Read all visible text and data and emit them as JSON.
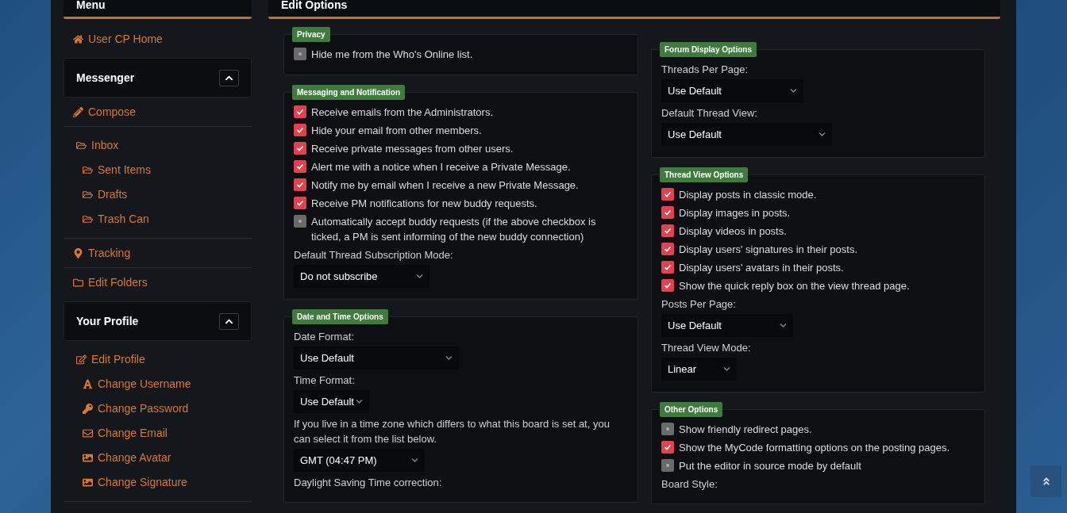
{
  "sidebar": {
    "title": "Menu",
    "top_link": {
      "label": "User CP Home"
    },
    "sections": [
      {
        "title": "Messenger",
        "expanded": true,
        "items": [
          {
            "label": "Compose"
          },
          {
            "label": "Inbox",
            "children": [
              {
                "label": "Sent Items"
              },
              {
                "label": "Drafts"
              },
              {
                "label": "Trash Can"
              }
            ]
          },
          {
            "label": "Tracking"
          },
          {
            "label": "Edit Folders"
          }
        ]
      },
      {
        "title": "Your Profile",
        "expanded": true,
        "items": [
          {
            "label": "Edit Profile",
            "children": [
              {
                "label": "Change Username"
              },
              {
                "label": "Change Password"
              },
              {
                "label": "Change Email"
              },
              {
                "label": "Change Avatar"
              },
              {
                "label": "Change Signature"
              }
            ]
          }
        ]
      }
    ]
  },
  "main": {
    "title": "Edit Options",
    "left_column": [
      {
        "legend": "Privacy",
        "fields": [
          {
            "kind": "checkbox",
            "label": "Hide me from the Who's Online list.",
            "checked": false
          }
        ]
      },
      {
        "legend": "Messaging and Notification",
        "fields": [
          {
            "kind": "checkbox",
            "label": "Receive emails from the Administrators.",
            "checked": true
          },
          {
            "kind": "checkbox",
            "label": "Hide your email from other members.",
            "checked": true
          },
          {
            "kind": "checkbox",
            "label": "Receive private messages from other users.",
            "checked": true
          },
          {
            "kind": "checkbox",
            "label": "Alert me with a notice when I receive a Private Message.",
            "checked": true
          },
          {
            "kind": "checkbox",
            "label": "Notify me by email when I receive a new Private Message.",
            "checked": true
          },
          {
            "kind": "checkbox",
            "label": "Receive PM notifications for new buddy requests.",
            "checked": true
          },
          {
            "kind": "checkbox",
            "label": "Automatically accept buddy requests (if the above checkbox is ticked, a PM is sent informing of the new buddy connection)",
            "checked": false
          },
          {
            "kind": "label",
            "text": "Default Thread Subscription Mode:"
          },
          {
            "kind": "select",
            "value": "Do not subscribe"
          }
        ]
      },
      {
        "legend": "Date and Time Options",
        "fields": [
          {
            "kind": "label",
            "text": "Date Format:"
          },
          {
            "kind": "select",
            "value": "Use Default"
          },
          {
            "kind": "label",
            "text": "Time Format:"
          },
          {
            "kind": "select",
            "value": "Use Default"
          },
          {
            "kind": "label",
            "text": "If you live in a time zone which differs to what this board is set at, you can select it from the list below."
          },
          {
            "kind": "select",
            "value": "GMT (04:47 PM)"
          },
          {
            "kind": "label",
            "text": "Daylight Saving Time correction:"
          }
        ]
      }
    ],
    "right_column": [
      {
        "legend": "Forum Display Options",
        "fields": [
          {
            "kind": "label",
            "text": "Threads Per Page:"
          },
          {
            "kind": "select",
            "value": "Use Default"
          },
          {
            "kind": "label",
            "text": "Default Thread View:"
          },
          {
            "kind": "select",
            "value": "Use Default"
          }
        ]
      },
      {
        "legend": "Thread View Options",
        "fields": [
          {
            "kind": "checkbox",
            "label": "Display posts in classic mode.",
            "checked": true
          },
          {
            "kind": "checkbox",
            "label": "Display images in posts.",
            "checked": true
          },
          {
            "kind": "checkbox",
            "label": "Display videos in posts.",
            "checked": true
          },
          {
            "kind": "checkbox",
            "label": "Display users' signatures in their posts.",
            "checked": true
          },
          {
            "kind": "checkbox",
            "label": "Display users' avatars in their posts.",
            "checked": true
          },
          {
            "kind": "checkbox",
            "label": "Show the quick reply box on the view thread page.",
            "checked": true
          },
          {
            "kind": "label",
            "text": "Posts Per Page:"
          },
          {
            "kind": "select",
            "value": "Use Default"
          },
          {
            "kind": "label",
            "text": "Thread View Mode:"
          },
          {
            "kind": "select",
            "value": "Linear"
          }
        ]
      },
      {
        "legend": "Other Options",
        "fields": [
          {
            "kind": "checkbox",
            "label": "Show friendly redirect pages.",
            "checked": false
          },
          {
            "kind": "checkbox",
            "label": "Show the MyCode formatting options on the posting pages.",
            "checked": true
          },
          {
            "kind": "checkbox",
            "label": "Put the editor in source mode by default",
            "checked": false
          },
          {
            "kind": "label",
            "text": "Board Style:"
          }
        ]
      }
    ]
  }
}
